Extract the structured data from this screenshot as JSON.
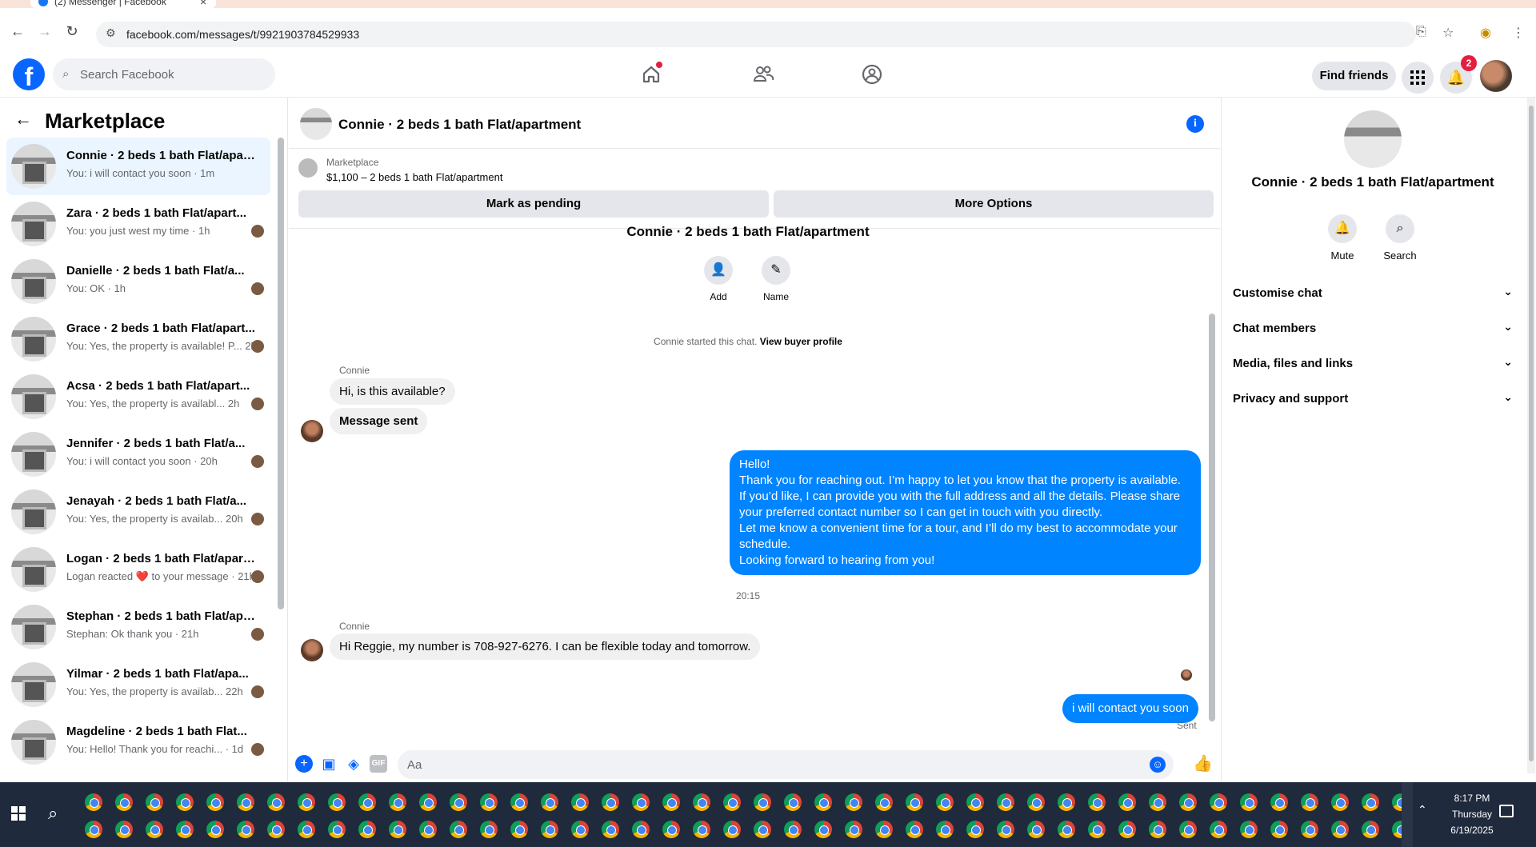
{
  "browser": {
    "tab_title": "(2) Messenger | Facebook",
    "url": "facebook.com/messages/t/9921903784529933"
  },
  "fb": {
    "search_placeholder": "Search Facebook",
    "find_friends": "Find friends",
    "notifications_count": "2"
  },
  "sidebar": {
    "title": "Marketplace",
    "conversations": [
      {
        "name": "Connie · 2 beds 1 bath Flat/apart...",
        "preview": "You: i will contact you soon · 1m",
        "active": true
      },
      {
        "name": "Zara · 2 beds 1 bath Flat/apart...",
        "preview": "You: you just west my time · 1h"
      },
      {
        "name": "Danielle · 2 beds 1 bath Flat/a...",
        "preview": "You: OK · 1h"
      },
      {
        "name": "Grace · 2 beds 1 bath Flat/apart...",
        "preview": "You: Yes, the property is available! P... 2h"
      },
      {
        "name": "Acsa · 2 beds 1 bath Flat/apart...",
        "preview": "You: Yes, the property is availabl...  2h"
      },
      {
        "name": "Jennifer · 2 beds 1 bath Flat/a...",
        "preview": "You: i will contact you soon · 20h"
      },
      {
        "name": "Jenayah · 2 beds 1 bath Flat/a...",
        "preview": "You: Yes, the property is availab... 20h"
      },
      {
        "name": "Logan · 2 beds 1 bath Flat/apart...",
        "preview": "Logan reacted ❤️ to your message · 21h"
      },
      {
        "name": "Stephan · 2 beds 1 bath Flat/apa...",
        "preview": "Stephan: Ok thank you · 21h"
      },
      {
        "name": "Yilmar · 2 beds 1 bath Flat/apa...",
        "preview": "You: Yes, the property is availab... 22h"
      },
      {
        "name": "Magdeline · 2 beds 1 bath Flat...",
        "preview": "You: Hello! Thank you for reachi... · 1d"
      }
    ]
  },
  "chat": {
    "header_title": "Connie · 2 beds 1 bath Flat/apartment",
    "listing_label": "Marketplace",
    "listing_price": "$1,100 – 2 beds 1 bath Flat/apartment",
    "mark_pending": "Mark as pending",
    "more_options": "More Options",
    "conv_title": "Connie · 2 beds 1 bath Flat/apartment",
    "add_label": "Add",
    "name_label": "Name",
    "started_text": "Connie started this chat.",
    "view_buyer": "View buyer profile",
    "sender1": "Connie",
    "msg1": "Hi, is this available?",
    "msg2": "Message sent",
    "reply_lines": [
      "Hello!",
      "Thank you for reaching out. I’m happy to let you know that the property is available.",
      "If you’d like, I can provide you with the full address and all the details. Please share",
      "your preferred contact number so I can get in touch with you directly.",
      "Let me know a convenient time for a tour, and I’ll do my best to accommodate your",
      "schedule.",
      "Looking forward to hearing from you!"
    ],
    "timestamp": "20:15",
    "sender2": "Connie",
    "msg3": "Hi Reggie, my number is 708-927-6276. I can be flexible today and tomorrow.",
    "msg4": "i will contact you soon",
    "sent": "Sent",
    "composer_placeholder": "Aa"
  },
  "right_panel": {
    "name": "Connie · 2 beds 1 bath Flat/apartment",
    "mute": "Mute",
    "search": "Search",
    "sections": [
      "Customise chat",
      "Chat members",
      "Media, files and links",
      "Privacy and support"
    ]
  },
  "taskbar": {
    "time": "8:17 PM",
    "day": "Thursday",
    "date": "6/19/2025"
  },
  "colors": {
    "accent": "#0866ff",
    "bubble_out": "#0084ff",
    "bubble_in": "#f0f0f0"
  }
}
